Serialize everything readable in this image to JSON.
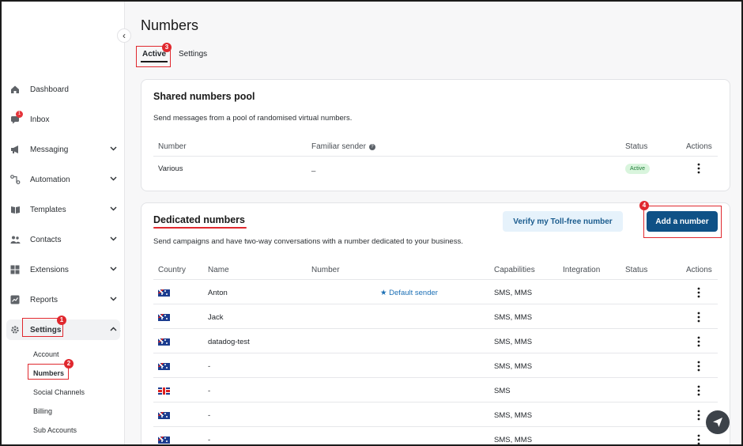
{
  "sidebar": {
    "items": [
      {
        "label": "Dashboard",
        "icon": "home-icon"
      },
      {
        "label": "Inbox",
        "icon": "chat-icon",
        "badge": "1"
      },
      {
        "label": "Messaging",
        "icon": "megaphone-icon"
      },
      {
        "label": "Automation",
        "icon": "flow-icon"
      },
      {
        "label": "Templates",
        "icon": "book-icon"
      },
      {
        "label": "Contacts",
        "icon": "people-icon"
      },
      {
        "label": "Extensions",
        "icon": "grid-icon"
      },
      {
        "label": "Reports",
        "icon": "chart-icon"
      }
    ],
    "settings": {
      "label": "Settings",
      "icon": "gear-icon"
    },
    "sub_items": [
      "Account",
      "Numbers",
      "Social Channels",
      "Billing",
      "Sub Accounts"
    ],
    "collapse_glyph": "‹"
  },
  "callouts": {
    "one": "1",
    "two": "2",
    "three": "3",
    "four": "4"
  },
  "page": {
    "title": "Numbers",
    "tabs": [
      "Active",
      "Settings"
    ]
  },
  "shared": {
    "title": "Shared numbers pool",
    "description": "Send messages from a pool of randomised virtual numbers.",
    "headers": {
      "number": "Number",
      "familiar": "Familiar sender",
      "status": "Status",
      "actions": "Actions"
    },
    "row": {
      "number": "Various",
      "familiar": "_",
      "status": "Active"
    },
    "info_glyph": "?"
  },
  "dedicated": {
    "title": "Dedicated numbers",
    "description": "Send campaigns and have two-way conversations with a number dedicated to your business.",
    "verify_label": "Verify my Toll-free number",
    "add_label": "Add a number",
    "headers": {
      "country": "Country",
      "name": "Name",
      "number": "Number",
      "capabilities": "Capabilities",
      "integration": "Integration",
      "status": "Status",
      "actions": "Actions"
    },
    "default_sender": "Default sender",
    "rows": [
      {
        "flag": "au",
        "name": "Anton",
        "capabilities": "SMS, MMS"
      },
      {
        "flag": "au",
        "name": "Jack",
        "capabilities": "SMS, MMS"
      },
      {
        "flag": "au",
        "name": "datadog-test",
        "capabilities": "SMS, MMS"
      },
      {
        "flag": "au",
        "name": "-",
        "capabilities": "SMS, MMS"
      },
      {
        "flag": "gb",
        "name": "-",
        "capabilities": "SMS"
      },
      {
        "flag": "au",
        "name": "-",
        "capabilities": "SMS, MMS"
      },
      {
        "flag": "au",
        "name": "-",
        "capabilities": "SMS, MMS"
      }
    ]
  },
  "colors": {
    "accent": "#0f5186",
    "callout": "#e0282e",
    "status_bg": "#d9f5dd"
  }
}
